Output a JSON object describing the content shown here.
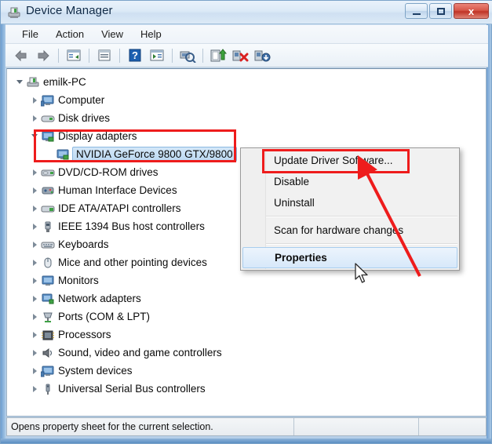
{
  "window": {
    "title": "Device Manager",
    "title_icon": "device-manager-icon",
    "buttons": {
      "minimize": "minimize-icon",
      "maximize": "maximize-icon",
      "close": "x"
    }
  },
  "menubar": {
    "items": [
      {
        "label": "File"
      },
      {
        "label": "Action"
      },
      {
        "label": "View"
      },
      {
        "label": "Help"
      }
    ]
  },
  "toolbar": {
    "buttons": [
      {
        "name": "back-icon"
      },
      {
        "name": "forward-icon"
      },
      {
        "name": "show-hide-console-tree-icon"
      },
      {
        "name": "properties-icon"
      },
      {
        "name": "help-icon"
      },
      {
        "name": "view-icon"
      },
      {
        "name": "scan-for-hardware-changes-icon"
      },
      {
        "name": "update-driver-software-icon"
      },
      {
        "name": "uninstall-icon"
      },
      {
        "name": "disable-icon"
      }
    ]
  },
  "tree": {
    "nodes": [
      {
        "label": "emilk-PC",
        "depth": 0,
        "state": "expanded",
        "icon": "computer-root-icon"
      },
      {
        "label": "Computer",
        "depth": 1,
        "state": "collapsed",
        "icon": "computer-icon"
      },
      {
        "label": "Disk drives",
        "depth": 1,
        "state": "collapsed",
        "icon": "disk-drive-icon"
      },
      {
        "label": "Display adapters",
        "depth": 1,
        "state": "expanded",
        "icon": "display-adapter-icon"
      },
      {
        "label": "NVIDIA GeForce 9800 GTX/9800",
        "depth": 2,
        "state": "leaf",
        "icon": "display-adapter-icon",
        "selected": true
      },
      {
        "label": "DVD/CD-ROM drives",
        "depth": 1,
        "state": "collapsed",
        "icon": "dvd-drive-icon"
      },
      {
        "label": "Human Interface Devices",
        "depth": 1,
        "state": "collapsed",
        "icon": "hid-icon"
      },
      {
        "label": "IDE ATA/ATAPI controllers",
        "depth": 1,
        "state": "collapsed",
        "icon": "ide-controller-icon"
      },
      {
        "label": "IEEE 1394 Bus host controllers",
        "depth": 1,
        "state": "collapsed",
        "icon": "firewire-icon"
      },
      {
        "label": "Keyboards",
        "depth": 1,
        "state": "collapsed",
        "icon": "keyboard-icon"
      },
      {
        "label": "Mice and other pointing devices",
        "depth": 1,
        "state": "collapsed",
        "icon": "mouse-icon"
      },
      {
        "label": "Monitors",
        "depth": 1,
        "state": "collapsed",
        "icon": "monitor-icon"
      },
      {
        "label": "Network adapters",
        "depth": 1,
        "state": "collapsed",
        "icon": "network-adapter-icon"
      },
      {
        "label": "Ports (COM & LPT)",
        "depth": 1,
        "state": "collapsed",
        "icon": "port-icon"
      },
      {
        "label": "Processors",
        "depth": 1,
        "state": "collapsed",
        "icon": "processor-icon"
      },
      {
        "label": "Sound, video and game controllers",
        "depth": 1,
        "state": "collapsed",
        "icon": "sound-icon"
      },
      {
        "label": "System devices",
        "depth": 1,
        "state": "collapsed",
        "icon": "system-device-icon"
      },
      {
        "label": "Universal Serial Bus controllers",
        "depth": 1,
        "state": "collapsed",
        "icon": "usb-icon"
      }
    ]
  },
  "context_menu": {
    "items": [
      {
        "label": "Update Driver Software...",
        "bold": false,
        "highlighted": false,
        "annotated": true
      },
      {
        "label": "Disable",
        "bold": false,
        "highlighted": false
      },
      {
        "label": "Uninstall",
        "bold": false,
        "highlighted": false
      },
      {
        "separator": true
      },
      {
        "label": "Scan for hardware changes",
        "bold": false,
        "highlighted": false
      },
      {
        "separator": true
      },
      {
        "label": "Properties",
        "bold": true,
        "highlighted": true
      }
    ]
  },
  "statusbar": {
    "text": "Opens property sheet for the current selection."
  },
  "annotations": {
    "box_color": "#ee1c1c",
    "arrow_color": "#ee1c1c",
    "tree_box_target": "Display adapters / NVIDIA GeForce 9800 GTX/9800",
    "menu_box_target": "Update Driver Software...",
    "arrow_points_to": "Update Driver Software..."
  },
  "colors": {
    "title_bar": "#dceaf7",
    "close_button": "#bf3326",
    "selection": "#bcd9f2",
    "window_border": "#7ba3c9"
  },
  "cursor": {
    "name": "mouse-pointer",
    "over": "Properties"
  }
}
